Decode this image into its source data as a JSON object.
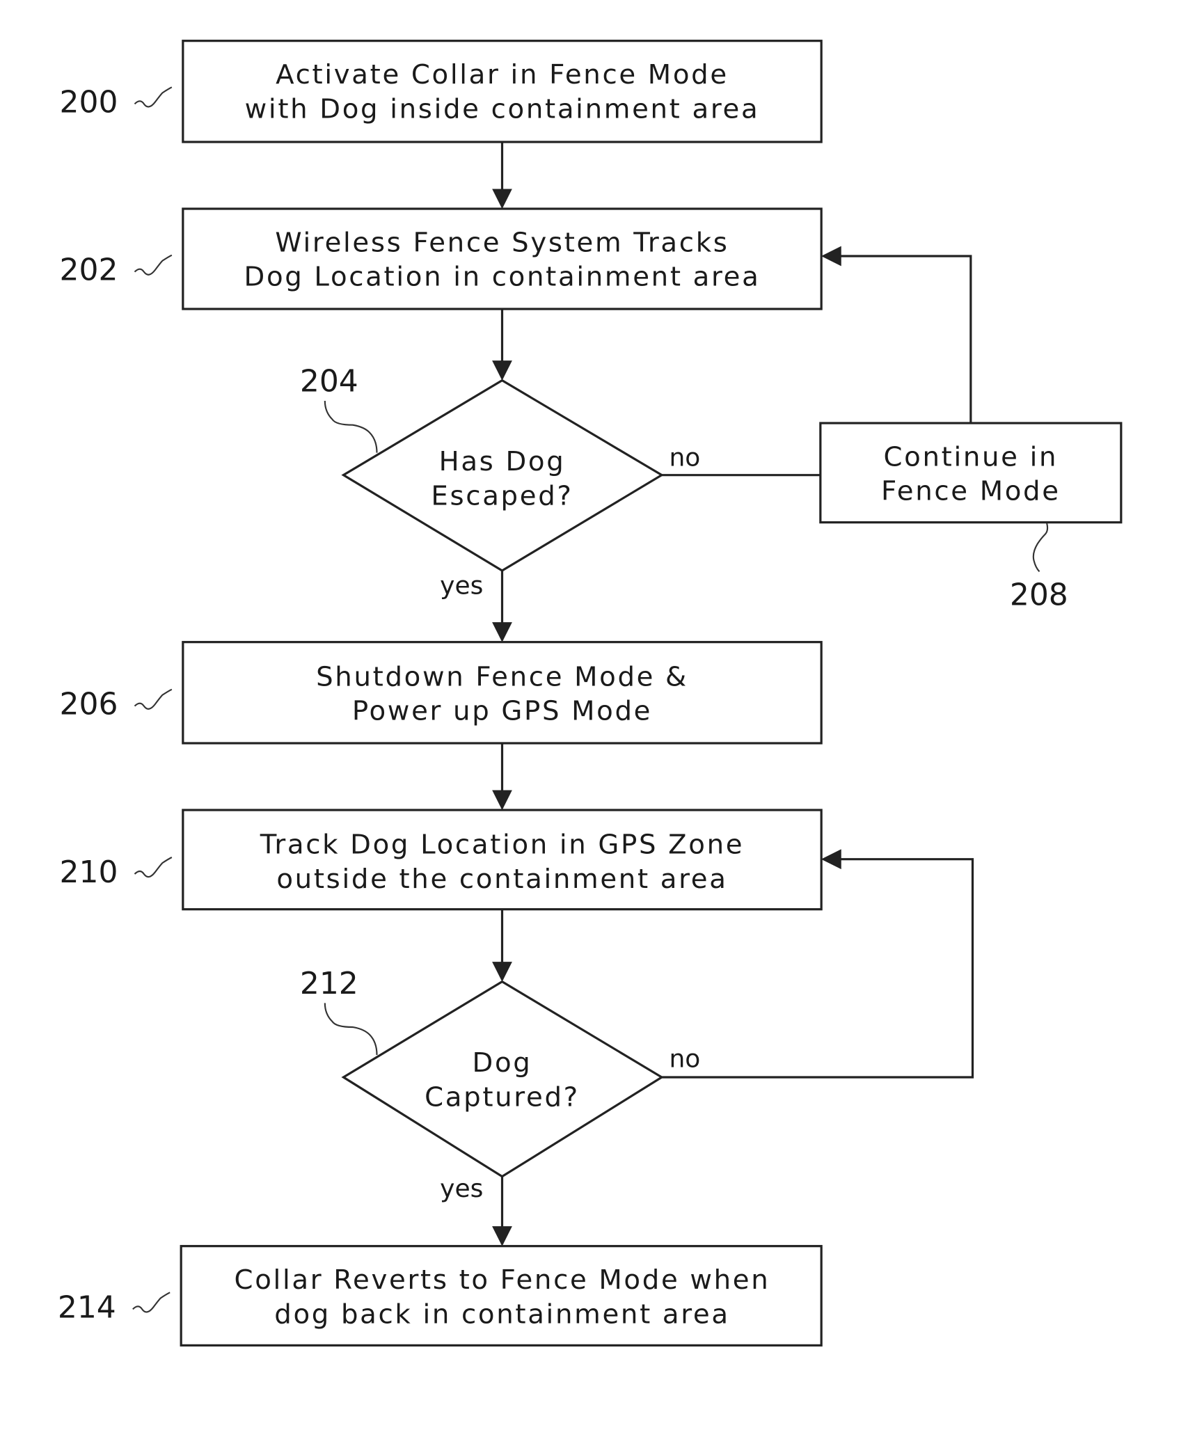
{
  "diagram": {
    "type": "flowchart",
    "nodes": [
      {
        "id": "200",
        "shape": "process",
        "ref": "200",
        "lines": [
          "Activate Collar in Fence Mode",
          "with Dog inside containment area"
        ]
      },
      {
        "id": "202",
        "shape": "process",
        "ref": "202",
        "lines": [
          "Wireless Fence System Tracks",
          "Dog Location in containment area"
        ]
      },
      {
        "id": "204",
        "shape": "decision",
        "ref": "204",
        "lines": [
          "Has Dog",
          "Escaped?"
        ]
      },
      {
        "id": "208",
        "shape": "process",
        "ref": "208",
        "lines": [
          "Continue in",
          "Fence Mode"
        ]
      },
      {
        "id": "206",
        "shape": "process",
        "ref": "206",
        "lines": [
          "Shutdown Fence Mode &",
          "Power up GPS Mode"
        ]
      },
      {
        "id": "210",
        "shape": "process",
        "ref": "210",
        "lines": [
          "Track Dog Location in GPS Zone",
          "outside the containment area"
        ]
      },
      {
        "id": "212",
        "shape": "decision",
        "ref": "212",
        "lines": [
          "Dog",
          "Captured?"
        ]
      },
      {
        "id": "214",
        "shape": "process",
        "ref": "214",
        "lines": [
          "Collar Reverts to Fence Mode when",
          "dog back in containment area"
        ]
      }
    ],
    "edges": [
      {
        "from": "200",
        "to": "202",
        "label": ""
      },
      {
        "from": "202",
        "to": "204",
        "label": ""
      },
      {
        "from": "204",
        "to": "208",
        "label": "no"
      },
      {
        "from": "208",
        "to": "202",
        "label": ""
      },
      {
        "from": "204",
        "to": "206",
        "label": "yes"
      },
      {
        "from": "206",
        "to": "210",
        "label": ""
      },
      {
        "from": "210",
        "to": "212",
        "label": ""
      },
      {
        "from": "212",
        "to": "210",
        "label": "no"
      },
      {
        "from": "212",
        "to": "214",
        "label": "yes"
      }
    ],
    "labels": {
      "no": "no",
      "yes": "yes"
    }
  }
}
